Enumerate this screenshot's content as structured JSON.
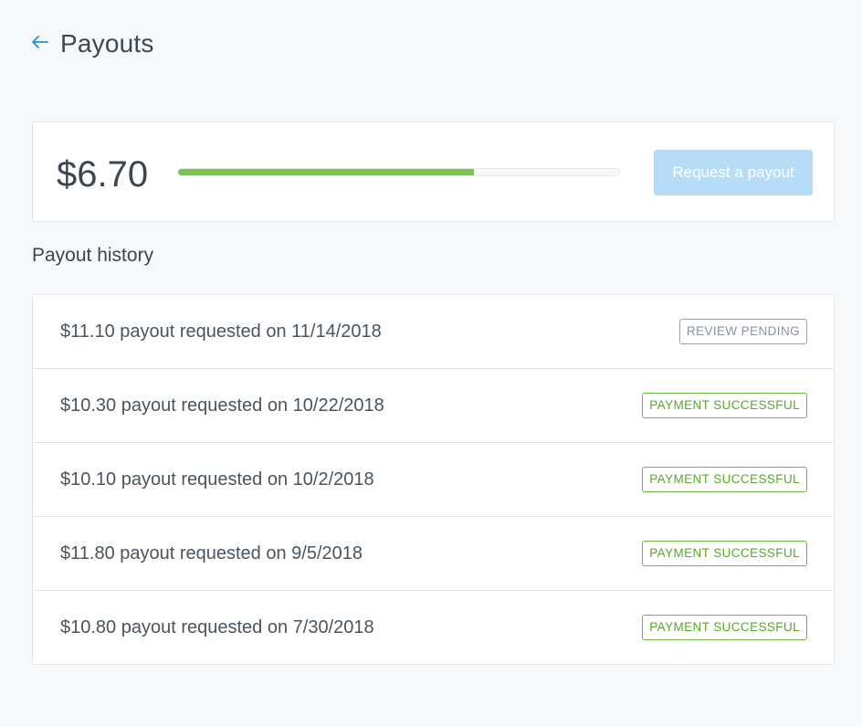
{
  "header": {
    "title": "Payouts",
    "back_icon": "arrow-left-icon"
  },
  "balance": {
    "amount": "$6.70",
    "progress_fraction": 0.67,
    "request_button_label": "Request a payout",
    "request_button_enabled": false
  },
  "history": {
    "title": "Payout history",
    "items": [
      {
        "text": "$11.10 payout requested on 11/14/2018",
        "status": "REVIEW PENDING",
        "status_kind": "pending"
      },
      {
        "text": "$10.30 payout requested on 10/22/2018",
        "status": "PAYMENT SUCCESSFUL",
        "status_kind": "success"
      },
      {
        "text": "$10.10 payout requested on 10/2/2018",
        "status": "PAYMENT SUCCESSFUL",
        "status_kind": "success"
      },
      {
        "text": "$11.80 payout requested on 9/5/2018",
        "status": "PAYMENT SUCCESSFUL",
        "status_kind": "success"
      },
      {
        "text": "$10.80 payout requested on 7/30/2018",
        "status": "PAYMENT SUCCESSFUL",
        "status_kind": "success"
      }
    ]
  },
  "colors": {
    "accent_blue": "#2d8fd5",
    "button_disabled_bg": "#b7dcf7",
    "progress_green": "#7ac74f",
    "success_green": "#5aa630",
    "pending_gray": "#8a939c"
  }
}
